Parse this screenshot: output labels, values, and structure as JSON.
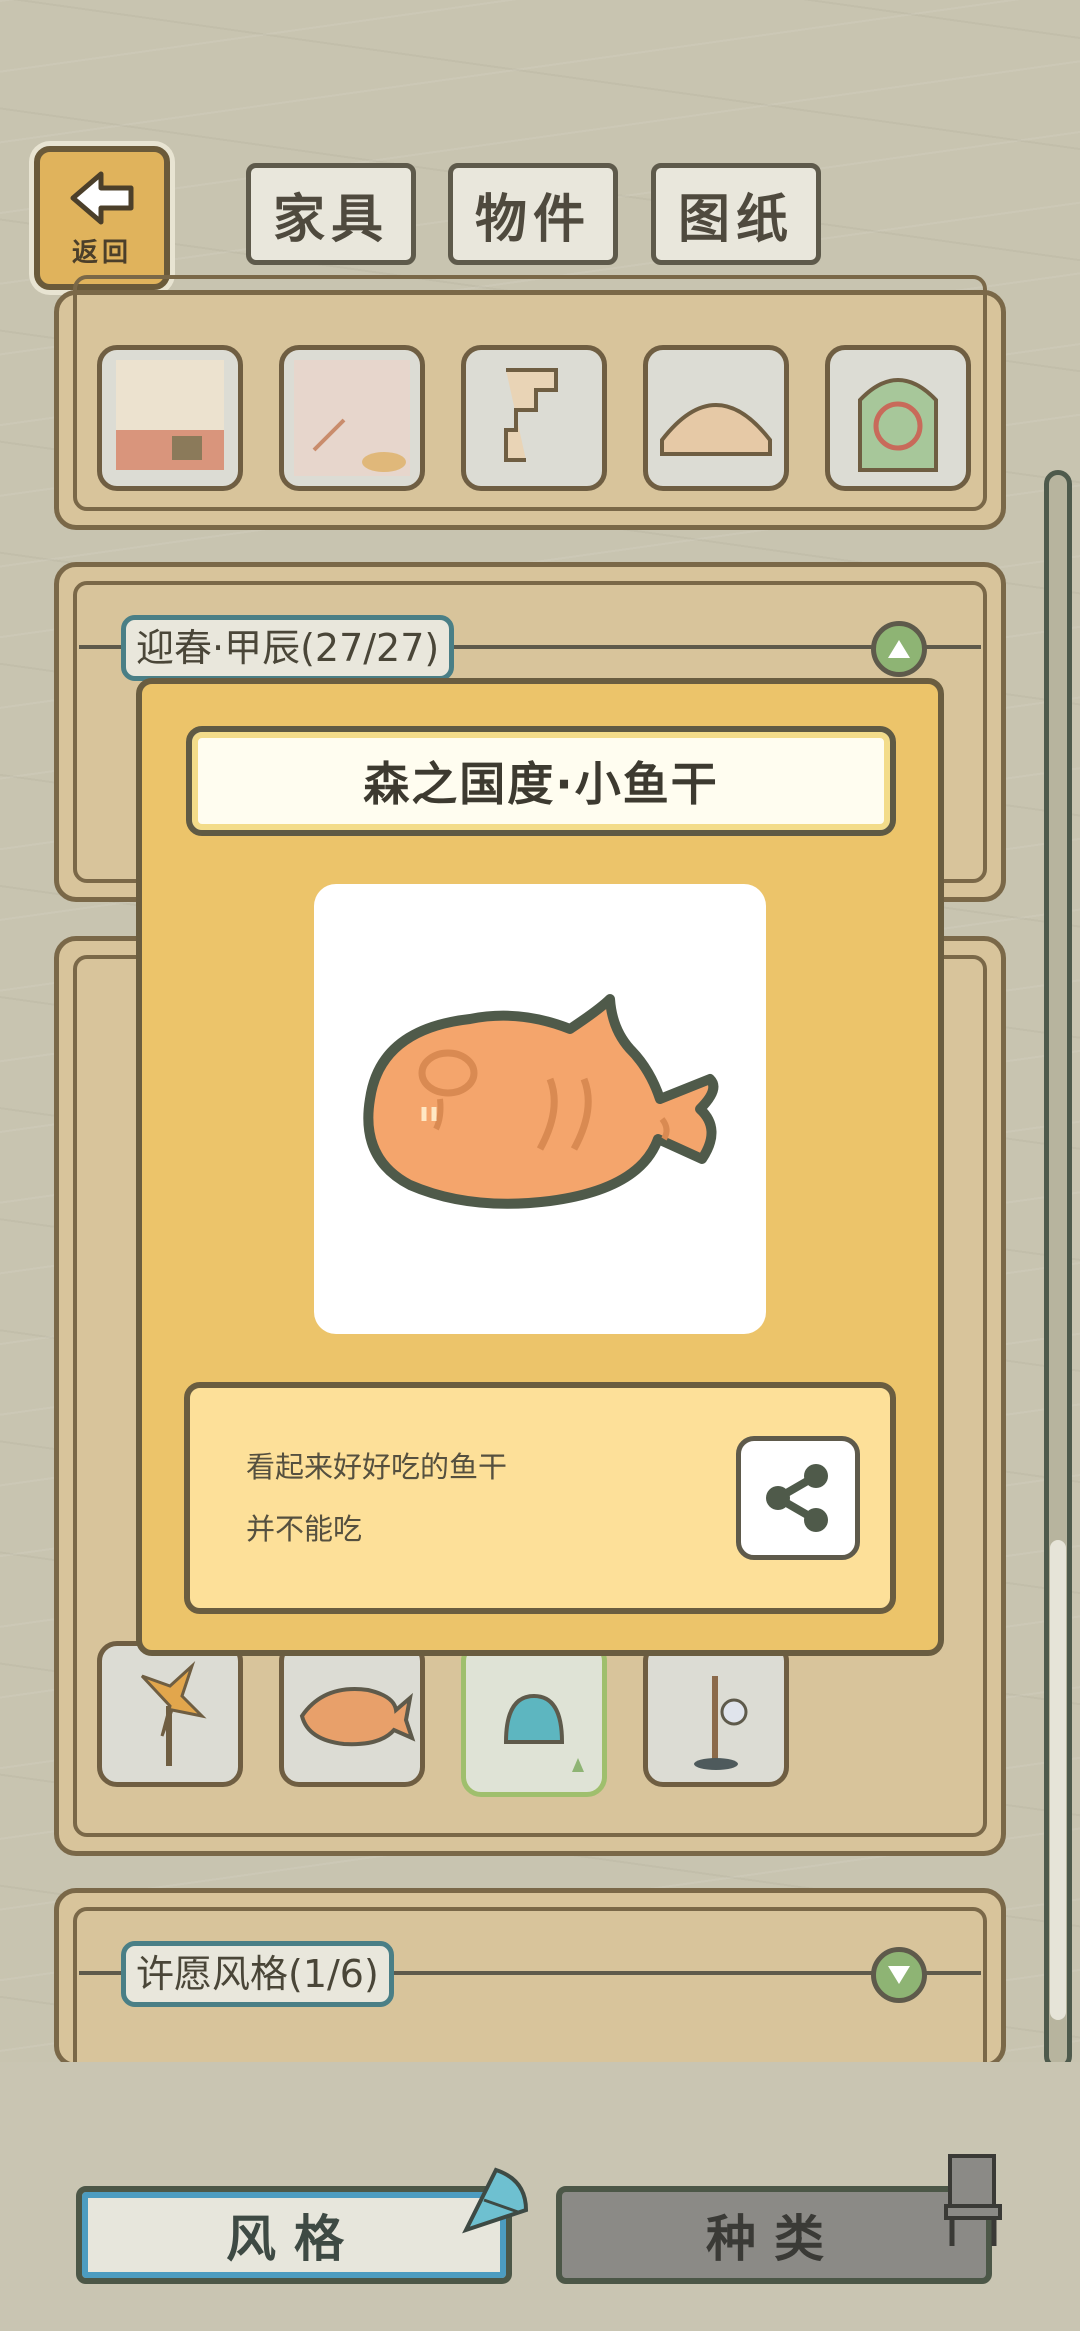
{
  "nav": {
    "back_label": "返回",
    "tabs": [
      "家具",
      "物件",
      "图纸"
    ]
  },
  "sections": [
    {
      "title": "迎春·甲辰(27/27)"
    },
    {
      "title": "许愿风格(1/6)"
    }
  ],
  "modal": {
    "title": "森之国度·小鱼干",
    "description_lines": [
      "看起来好好吃的鱼干",
      "并不能吃"
    ]
  },
  "bottom": {
    "style_label": "风格",
    "kind_label": "种类"
  },
  "colors": {
    "modal_bg": "#ecc46a",
    "accent_blue": "#4c9cc0",
    "toggle_green": "#8eb474"
  }
}
